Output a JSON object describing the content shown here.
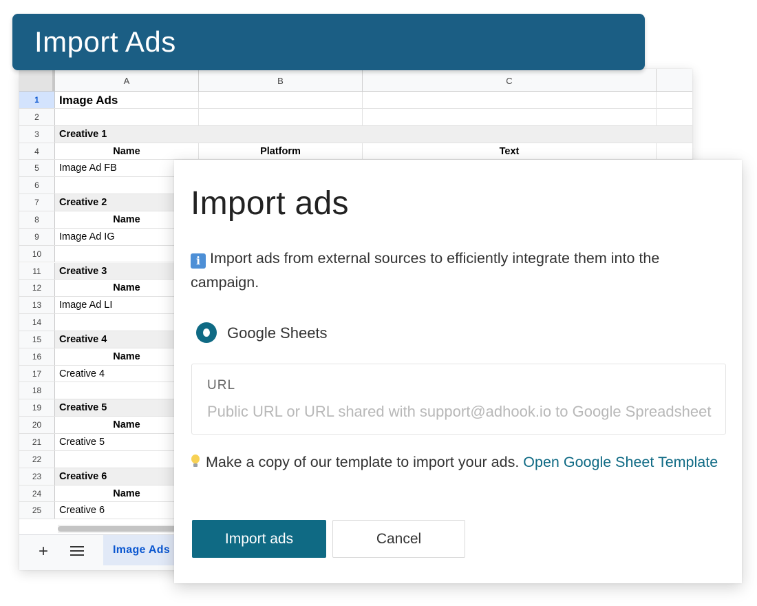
{
  "banner": {
    "title": "Import Ads"
  },
  "sheet": {
    "columns": [
      "A",
      "B",
      "C"
    ],
    "rows": [
      {
        "num": "1",
        "a": "Image Ads",
        "b": "",
        "c": "",
        "style": "title"
      },
      {
        "num": "2",
        "a": "",
        "b": "",
        "c": "",
        "style": "blank"
      },
      {
        "num": "3",
        "a": "Creative 1",
        "b": "",
        "c": "",
        "style": "section"
      },
      {
        "num": "4",
        "a": "Name",
        "b": "Platform",
        "c": "Text",
        "style": "header"
      },
      {
        "num": "5",
        "a": "Image Ad FB",
        "b": "",
        "c": "",
        "style": "data"
      },
      {
        "num": "6",
        "a": "",
        "b": "",
        "c": "",
        "style": "blank"
      },
      {
        "num": "7",
        "a": "Creative 2",
        "b": "",
        "c": "",
        "style": "section"
      },
      {
        "num": "8",
        "a": "Name",
        "b": "",
        "c": "",
        "style": "header"
      },
      {
        "num": "9",
        "a": "Image Ad IG",
        "b": "",
        "c": "",
        "style": "data"
      },
      {
        "num": "10",
        "a": "",
        "b": "",
        "c": "",
        "style": "blank"
      },
      {
        "num": "11",
        "a": "Creative 3",
        "b": "",
        "c": "",
        "style": "section"
      },
      {
        "num": "12",
        "a": "Name",
        "b": "",
        "c": "",
        "style": "header"
      },
      {
        "num": "13",
        "a": "Image Ad LI",
        "b": "",
        "c": "",
        "style": "data"
      },
      {
        "num": "14",
        "a": "",
        "b": "",
        "c": "",
        "style": "blank"
      },
      {
        "num": "15",
        "a": "Creative 4",
        "b": "",
        "c": "",
        "style": "section"
      },
      {
        "num": "16",
        "a": "Name",
        "b": "",
        "c": "",
        "style": "header"
      },
      {
        "num": "17",
        "a": "Creative 4",
        "b": "",
        "c": "",
        "style": "data"
      },
      {
        "num": "18",
        "a": "",
        "b": "",
        "c": "",
        "style": "blank"
      },
      {
        "num": "19",
        "a": "Creative 5",
        "b": "",
        "c": "",
        "style": "section"
      },
      {
        "num": "20",
        "a": "Name",
        "b": "",
        "c": "",
        "style": "header"
      },
      {
        "num": "21",
        "a": "Creative 5",
        "b": "",
        "c": "",
        "style": "data"
      },
      {
        "num": "22",
        "a": "",
        "b": "",
        "c": "",
        "style": "blank"
      },
      {
        "num": "23",
        "a": "Creative 6",
        "b": "",
        "c": "",
        "style": "section"
      },
      {
        "num": "24",
        "a": "Name",
        "b": "",
        "c": "",
        "style": "header"
      },
      {
        "num": "25",
        "a": "Creative 6",
        "b": "",
        "c": "",
        "style": "data"
      }
    ],
    "tabs": {
      "add": "+",
      "active": "Image Ads"
    }
  },
  "dialog": {
    "title": "Import ads",
    "info_icon": "i",
    "info_text": "Import ads from external sources to efficiently integrate them into the campaign.",
    "source_option": "Google Sheets",
    "url_label": "URL",
    "url_placeholder": "Public URL or URL shared with support@adhook.io to Google Spreadsheet",
    "url_value": "",
    "tip_text": "Make a copy of our template to import your ads.",
    "tip_link": "Open Google Sheet Template",
    "primary_button": "Import ads",
    "secondary_button": "Cancel"
  },
  "colors": {
    "banner": "#1b5e84",
    "accent": "#0f6a84",
    "sheet_tab": "#0b57d0"
  },
  "icons": {
    "info": "info-icon",
    "tip": "lightbulb-icon",
    "add_sheet": "plus-icon",
    "all_sheets": "hamburger-menu-icon"
  }
}
